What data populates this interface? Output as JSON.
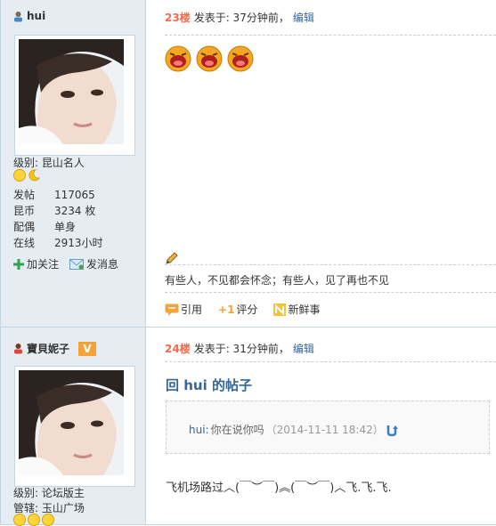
{
  "post1": {
    "author": "hui",
    "level_label": "级别: 昆山名人",
    "stats": [
      {
        "key": "发帖",
        "value": "117065"
      },
      {
        "key": "昆币",
        "value": "3234 枚"
      },
      {
        "key": "配偶",
        "value": "单身"
      },
      {
        "key": "在线",
        "value": "2913小时"
      }
    ],
    "follow": "加关注",
    "message": "发消息",
    "floor": "23楼",
    "posted": "发表于: 37分钟前，",
    "edit": "编辑",
    "signature": "有些人，不见都会怀念；有些人，见了再也不见",
    "quote_btn": "引用",
    "rate_btn": "评分",
    "fresh_btn": "新鲜事"
  },
  "post2": {
    "author": "寶貝妮子",
    "vip": "V",
    "level_label": "级别: 论坛版主",
    "manage_label": "管辖: 玉山广场",
    "floor": "24楼",
    "posted": "发表于: 31分钟前，",
    "edit": "编辑",
    "reply_title": "回 hui 的帖子",
    "quote_user": "hui:",
    "quote_text": "你在说你吗",
    "quote_time": "（2014-11-11 18:42）",
    "content": "飞机场路过︿(￣︶￣)︽(￣︶￣)︿飞.飞.飞."
  },
  "colors": {
    "accent": "#336699",
    "floor": "#f26c4f",
    "sidebar": "#e5edf2",
    "border": "#c2d5e3"
  }
}
